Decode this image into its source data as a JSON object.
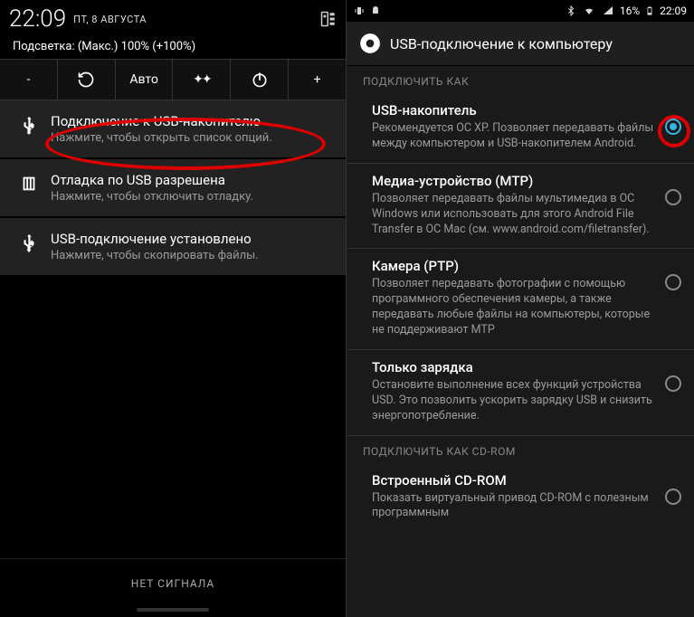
{
  "left": {
    "time": "22:09",
    "date": "ПТ, 8 АВГУСТА",
    "brightness_line": "Подсветка: (Макс.) 100% (+100%)",
    "toolbar": {
      "minus": "-",
      "auto": "Авто",
      "plus": "+"
    },
    "notifications": [
      {
        "title": "Подключение к USB-накопителю",
        "sub": "Нажмите, чтобы открыть список опций."
      },
      {
        "title": "Отладка по USB разрешена",
        "sub": "Нажмите, чтобы отключить отладку."
      },
      {
        "title": "USB-подключение установлено",
        "sub": "Нажмите, чтобы скопировать файлы."
      }
    ],
    "no_signal": "НЕТ СИГНАЛА"
  },
  "right": {
    "battery_pct": "16%",
    "time": "22:09",
    "title": "USB-подключение к компьютеру",
    "section1": "ПОДКЛЮЧИТЬ КАК",
    "options": [
      {
        "title": "USB-накопитель",
        "desc": "Рекомендуется ОС XP. Позволяет передавать файлы между компьютером и USB-накопителем Android."
      },
      {
        "title": "Медиа-устройство (MTP)",
        "desc": "Позволяет передавать файлы мультимедиа в ОС Windows или использовать для этого Android File Transfer в ОС Mac (см. www.android.com/filetransfer)."
      },
      {
        "title": "Камера (PTP)",
        "desc": "Позволяет передавать фотографии с помощью программного обеспечения камеры, а также передавать любые файлы на компьютеры, которые не поддерживают MTP"
      },
      {
        "title": "Только зарядка",
        "desc": "Остановите выполнение всех функций устройства USD. Это позволить ускорить зарядку USB и снизить энергопотребление."
      }
    ],
    "section2": "ПОДКЛЮЧИТЬ КАК CD-ROM",
    "cdrom": {
      "title": "Встроенный CD-ROM",
      "desc": "Показать виртуальный привод CD-ROM с полезным программным"
    }
  }
}
